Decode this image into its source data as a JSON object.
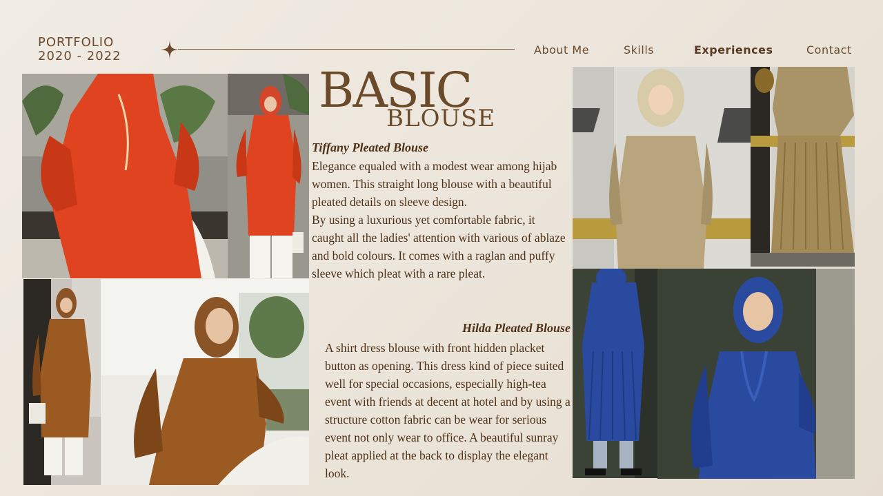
{
  "header": {
    "brand_line1": "PORTFOLIO",
    "brand_line2": "2020 - 2022",
    "nav": [
      "About Me",
      "Skills",
      "Experiences",
      "Contact"
    ],
    "active_nav": "Experiences"
  },
  "title": {
    "line1": "BASIC",
    "line2": "BLOUSE"
  },
  "section1": {
    "heading": "Tiffany Pleated Blouse",
    "paragraphs": [
      "Elegance equaled with a modest wear among hijab women. This straight long blouse with a beautiful pleated details on sleeve design.",
      "By using a luxurious yet comfortable fabric, it caught all the ladies' attention with various of ablaze and bold colours. It comes with a raglan and puffy sleeve which pleat with a rare pleat."
    ]
  },
  "section2": {
    "heading": "Hilda Pleated Blouse",
    "paragraphs": [
      "A shirt dress blouse with front hidden placket button as opening. This dress kind of piece suited well for special occasions, especially high-tea event with friends at decent at hotel and by using a structure cotton fabric can be wear for serious event not only wear to office. A beautiful sunray pleat applied at the back to display the elegant look."
    ]
  },
  "colors": {
    "background": "#eee8df",
    "text": "#4e3016",
    "orange_blouse": "#e0431f",
    "brown_blouse": "#9a5a22",
    "beige_blouse": "#b9a57d",
    "blue_blouse": "#2a4aa0"
  },
  "icons": {
    "divider_star": "four-point-star-icon"
  }
}
